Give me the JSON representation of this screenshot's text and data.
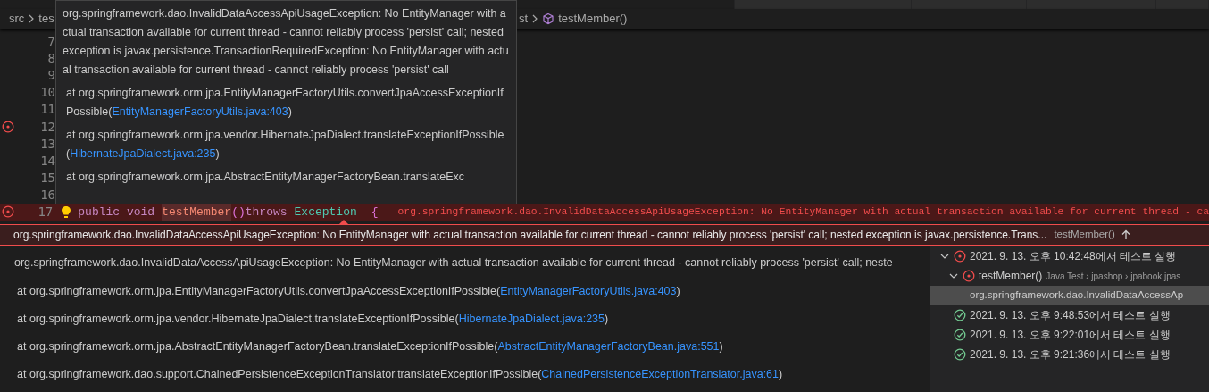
{
  "tabs": [
    {
      "selected": true
    },
    {
      "selected": false
    },
    {
      "selected": false
    },
    {
      "selected": false
    },
    {
      "selected": false
    }
  ],
  "breadcrumb": {
    "left": [
      "src",
      "tes"
    ],
    "right": [
      "st",
      "testMember()"
    ]
  },
  "editor": {
    "lines": [
      {
        "number": "7",
        "error": false
      },
      {
        "number": "8",
        "error": false
      },
      {
        "number": "9",
        "error": false
      },
      {
        "number": "10",
        "error": false
      },
      {
        "number": "11",
        "error": false
      },
      {
        "number": "12",
        "error": true
      },
      {
        "number": "13",
        "error": false
      },
      {
        "number": "14",
        "error": false
      },
      {
        "number": "15",
        "error": false
      },
      {
        "number": "16",
        "error": false
      },
      {
        "number": "17",
        "error": true,
        "lightbulb": true,
        "code": [
          {
            "kind": "keyword",
            "text": "public void"
          },
          {
            "kind": "method",
            "text": "testMember"
          },
          {
            "kind": "paren",
            "text": "()"
          },
          {
            "kind": "keyword",
            "text": "throws"
          },
          {
            "kind": "type",
            "text": "Exception"
          },
          {
            "kind": "paren",
            "text": "{"
          }
        ],
        "inline_error": "org.springframework.dao.InvalidDataAccessApiUsageException: No EntityManager with actual transaction available for current thread - ca"
      }
    ]
  },
  "hover": {
    "message": "org.springframework.dao.InvalidDataAccessApiUsageException: No EntityManager with actual transaction available for current thread - cannot reliably process 'persist' call; nested exception is javax.persistence.TransactionRequiredException: No EntityManager with actual transaction available for current thread - cannot reliably process 'persist' call",
    "frames": [
      {
        "text": "at org.springframework.orm.jpa.EntityManagerFactoryUtils.convertJpaAccessExceptionIfPossible(",
        "link": "EntityManagerFactoryUtils.java:403",
        "close": ")"
      },
      {
        "text": "at org.springframework.orm.jpa.vendor.HibernateJpaDialect.translateExceptionIfPossible(",
        "link": "HibernateJpaDialect.java:235",
        "close": ")"
      },
      {
        "text": "at org.springframework.orm.jpa.AbstractEntityManagerFactoryBean.translateExc"
      }
    ]
  },
  "peek": {
    "title": "org.springframework.dao.InvalidDataAccessApiUsageException: No EntityManager with actual transaction available for current thread - cannot reliably process 'persist' call; nested exception is javax.persistence.Trans...",
    "test": "testMember()",
    "message": "org.springframework.dao.InvalidDataAccessApiUsageException: No EntityManager with actual transaction available for current thread - cannot reliably process 'persist' call; neste",
    "frames": [
      {
        "text": "at org.springframework.orm.jpa.EntityManagerFactoryUtils.convertJpaAccessExceptionIfPossible(",
        "link": "EntityManagerFactoryUtils.java:403",
        "close": ")"
      },
      {
        "text": "at org.springframework.orm.jpa.vendor.HibernateJpaDialect.translateExceptionIfPossible(",
        "link": "HibernateJpaDialect.java:235",
        "close": ")"
      },
      {
        "text": "at org.springframework.orm.jpa.AbstractEntityManagerFactoryBean.translateExceptionIfPossible(",
        "link": "AbstractEntityManagerFactoryBean.java:551",
        "close": ")"
      },
      {
        "text": "at org.springframework.dao.support.ChainedPersistenceExceptionTranslator.translateExceptionIfPossible(",
        "link": "ChainedPersistenceExceptionTranslator.java:61",
        "close": ")"
      }
    ],
    "history": [
      {
        "label": "2021. 9. 13. 오후 10:42:48에서 테스트 실행",
        "kind": "failed",
        "expanded": true,
        "selected": false,
        "children": [
          {
            "label": "testMember()",
            "description": "Java Test › jpashop › jpabook.jpas",
            "kind": "failed",
            "expanded": true,
            "selected": false,
            "children": [
              {
                "label": "org.springframework.dao.InvalidDataAccessAp",
                "kind": "message",
                "selected": true
              }
            ]
          }
        ]
      },
      {
        "label": "2021. 9. 13. 오후 9:48:53에서 테스트 실행",
        "kind": "passed",
        "selected": false
      },
      {
        "label": "2021. 9. 13. 오후 9:22:01에서 테스트 실행",
        "kind": "passed",
        "selected": false
      },
      {
        "label": "2021. 9. 13. 오후 9:21:36에서 테스트 실행",
        "kind": "passed",
        "selected": false
      }
    ]
  }
}
